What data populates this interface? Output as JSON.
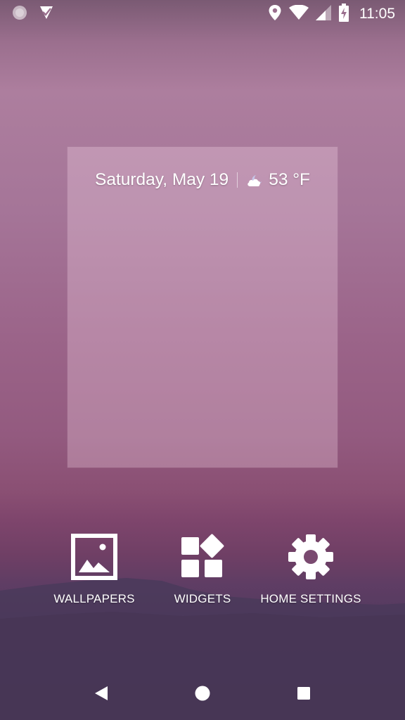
{
  "status_bar": {
    "time": "11:05",
    "left_icons": [
      "circle-status-icon",
      "check-notification-icon"
    ],
    "right_icons": [
      "location-icon",
      "wifi-icon",
      "signal-icon",
      "battery-charging-icon"
    ]
  },
  "widget": {
    "date": "Saturday, May 19",
    "temperature": "53 °F",
    "weather_icon": "partly-cloudy-night-icon"
  },
  "actions": [
    {
      "label": "WALLPAPERS",
      "icon": "wallpaper-icon"
    },
    {
      "label": "WIDGETS",
      "icon": "widgets-icon"
    },
    {
      "label": "HOME SETTINGS",
      "icon": "gear-icon"
    }
  ],
  "nav_bar": {
    "buttons": [
      "back-icon",
      "home-icon",
      "recents-icon"
    ]
  }
}
